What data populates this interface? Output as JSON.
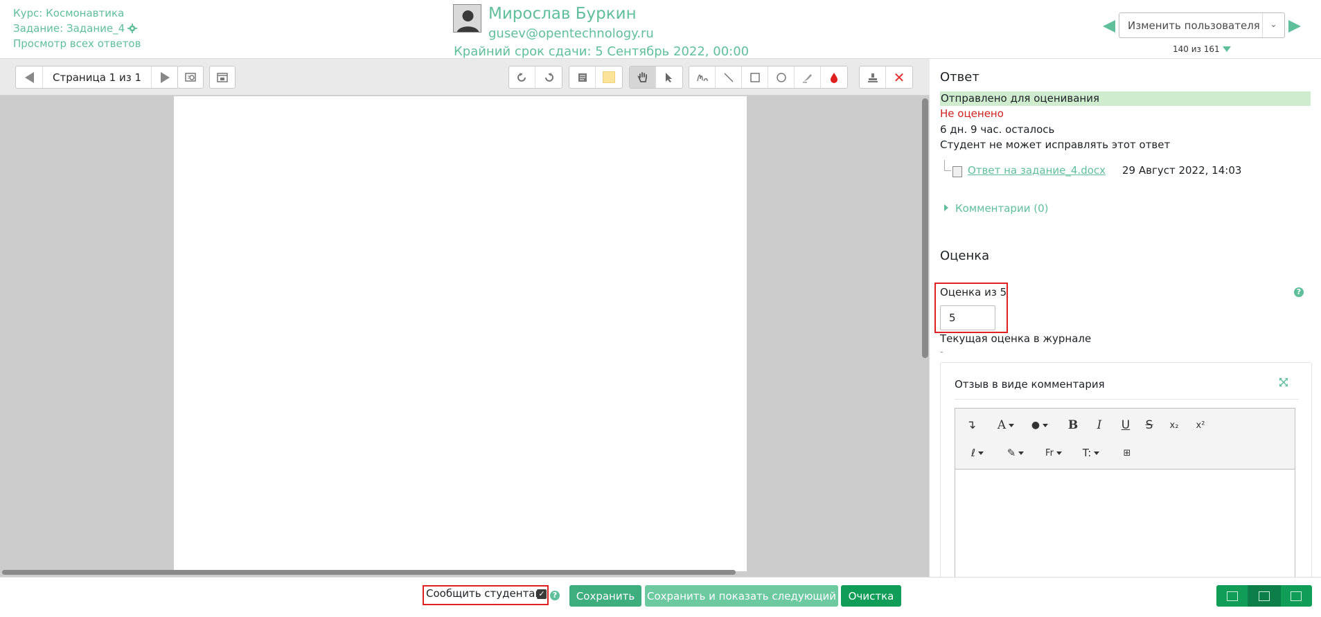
{
  "header": {
    "course_link": "Курс: Космонавтика",
    "assignment_link": "Задание: Задание_4",
    "view_all_link": "Просмотр всех ответов",
    "user_name": "Мирослав Буркин",
    "user_email": "gusev@opentechnology.ru",
    "due_date": "Крайний срок сдачи: 5 Сентябрь 2022, 00:00",
    "change_user_placeholder": "Изменить пользователя",
    "counter": "140 из 161"
  },
  "viewer": {
    "page_label": "Страница 1 из 1",
    "tools": [
      "rotate-left-icon",
      "rotate-right-icon",
      "comment-icon",
      "comment-color-swatch",
      "hand-icon",
      "select-pointer-icon",
      "pen-icon",
      "line-icon",
      "rectangle-icon",
      "oval-icon",
      "highlighter-icon",
      "color-drop-icon",
      "stamp-icon",
      "delete-icon"
    ]
  },
  "panel": {
    "answer_heading": "Ответ",
    "status_submitted": "Отправлено для оценивания",
    "status_grading": "Не оценено",
    "time_left": "6 дн. 9 час. осталось",
    "edit_status": "Студент не может исправлять этот ответ",
    "file_name": "Ответ на задание_4.docx",
    "file_date": "29 Август 2022, 14:03",
    "comments_toggle": "Комментарии (0)",
    "grade_heading": "Оценка",
    "grade_label": "Оценка из 5",
    "grade_value": "5",
    "journal_label": "Текущая оценка в журнале",
    "journal_value": "-",
    "feedback_title": "Отзыв в виде комментария"
  },
  "footer": {
    "notify_label": "Сообщить студентам",
    "notify_checked": true,
    "save_button": "Сохранить",
    "save_next_button": "Сохранить и показать следующий",
    "reset_button": "Очистка"
  },
  "colors": {
    "accent": "#5fbf9a",
    "primary_green": "#0f9d58",
    "save_green": "#3fae7f",
    "save_next_green": "#6cc9a0",
    "error_red": "#d02020",
    "status_bg": "#cfeccf",
    "viewer_bg": "#cccccc"
  }
}
